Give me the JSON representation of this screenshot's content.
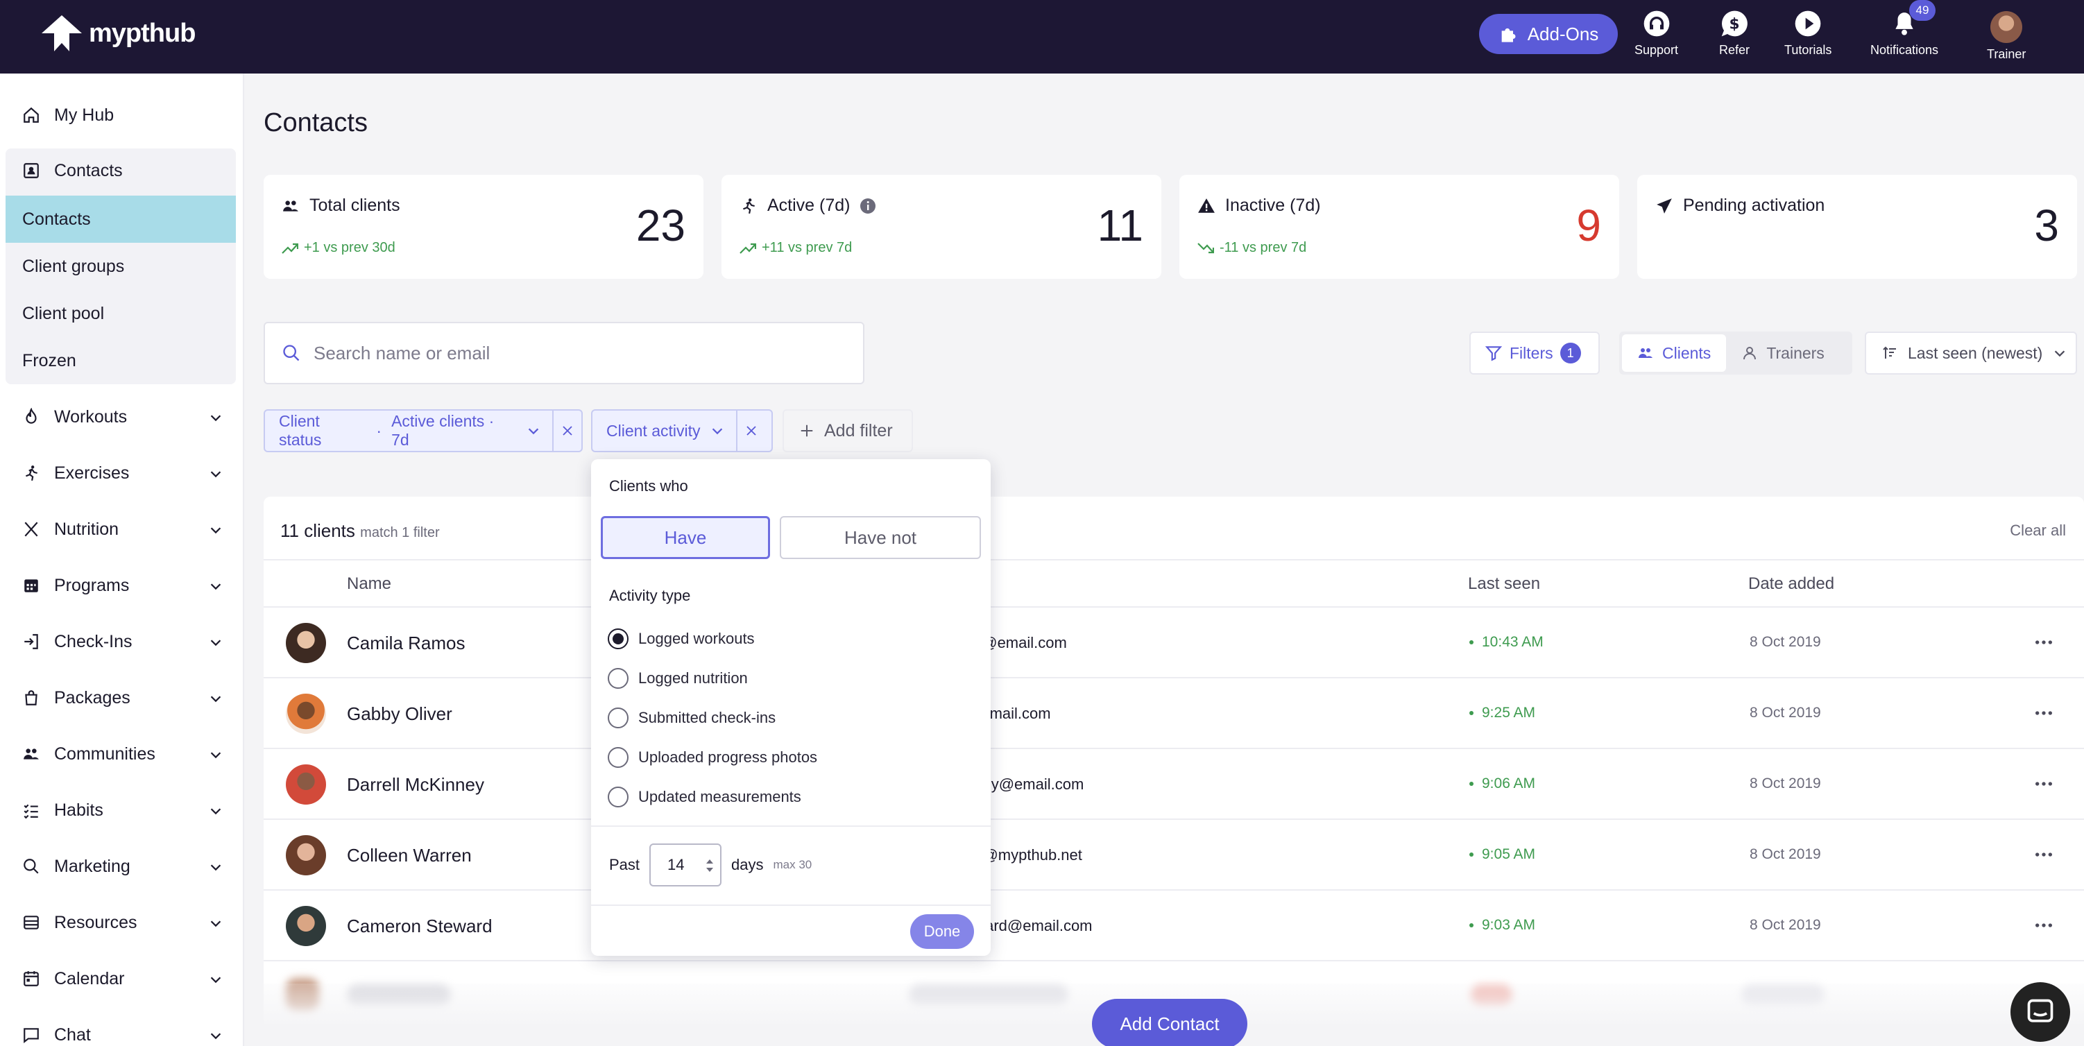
{
  "app": {
    "logo_text": "mypthub"
  },
  "header": {
    "addons_label": "Add-Ons",
    "support_label": "Support",
    "refer_label": "Refer",
    "tutorials_label": "Tutorials",
    "notifications_label": "Notifications",
    "notifications_count": "49",
    "trainer_label": "Trainer"
  },
  "sidebar": {
    "my_hub": "My Hub",
    "contacts_group": "Contacts",
    "sub_items": [
      "Contacts",
      "Client groups",
      "Client pool",
      "Frozen"
    ],
    "items": [
      "Workouts",
      "Exercises",
      "Nutrition",
      "Programs",
      "Check-Ins",
      "Packages",
      "Communities",
      "Habits",
      "Marketing",
      "Resources",
      "Calendar",
      "Chat"
    ]
  },
  "page": {
    "title": "Contacts"
  },
  "stats": [
    {
      "label": "Total clients",
      "delta": "+1 vs prev 30d",
      "value": "23"
    },
    {
      "label": "Active (7d)",
      "delta": "+11 vs prev 7d",
      "value": "11"
    },
    {
      "label": "Inactive (7d)",
      "delta": "-11 vs prev 7d",
      "value": "9"
    },
    {
      "label": "Pending activation",
      "delta": "",
      "value": "3"
    }
  ],
  "search": {
    "placeholder": "Search name or email"
  },
  "controls": {
    "filters_label": "Filters",
    "filters_count": "1",
    "clients_label": "Clients",
    "trainers_label": "Trainers",
    "sort_label": "Last seen (newest)"
  },
  "chips": {
    "status_label": "Client status",
    "status_sep": "·",
    "status_value": "Active clients · 7d",
    "activity_label": "Client activity",
    "add_filter": "Add filter"
  },
  "table": {
    "count": "11 clients",
    "match": "match 1 filter",
    "clear_all": "Clear all",
    "columns": {
      "name": "Name",
      "last_seen": "Last seen",
      "date_added": "Date added"
    },
    "rows": [
      {
        "name": "Camila Ramos",
        "email": "os@email.com",
        "last_seen": "10:43 AM",
        "date_added": "8 Oct 2019"
      },
      {
        "name": "Gabby Oliver",
        "email": "@email.com",
        "last_seen": "9:25 AM",
        "date_added": "8 Oct 2019"
      },
      {
        "name": "Darrell McKinney",
        "email": "nney@email.com",
        "last_seen": "9:06 AM",
        "date_added": "8 Oct 2019"
      },
      {
        "name": "Colleen Warren",
        "email": "en@mypthub.net",
        "last_seen": "9:05 AM",
        "date_added": "8 Oct 2019"
      },
      {
        "name": "Cameron Steward",
        "email": "eward@email.com",
        "last_seen": "9:03 AM",
        "date_added": "8 Oct 2019"
      }
    ]
  },
  "popover": {
    "clients_who": "Clients who",
    "have": "Have",
    "have_not": "Have not",
    "activity_type": "Activity type",
    "options": [
      "Logged workouts",
      "Logged nutrition",
      "Submitted check-ins",
      "Uploaded progress photos",
      "Updated measurements"
    ],
    "selected_option": "Logged workouts",
    "past_label": "Past",
    "past_value": "14",
    "days_label": "days",
    "max_label": "max 30",
    "done": "Done"
  },
  "footer": {
    "add_contact": "Add Contact"
  },
  "colors": {
    "accent": "#5b5bd8",
    "topbar": "#1d1734",
    "positive": "#3e9b4f",
    "negative": "#d63a2f",
    "active_sidebar": "#a8dce8"
  }
}
